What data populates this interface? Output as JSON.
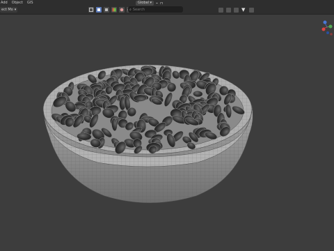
{
  "menu": {
    "items": [
      "Add",
      "Object",
      "GIS"
    ]
  },
  "mode": {
    "label": "Object Mode",
    "short": "ect Mo"
  },
  "header": {
    "pivot_label": "Global",
    "search_placeholder": "Search"
  },
  "icons": [
    "select-box-icon",
    "move-icon",
    "tool-icon",
    "gradient-icon",
    "color-icon",
    "nodes-icon",
    "refresh-icon",
    "filter-icon",
    "view-icon"
  ],
  "colors": {
    "background": "#3d3d3d",
    "header": "#2e2e2e",
    "accent": "#5a79b8",
    "mesh_fill": "#9a9a9a",
    "seed_fill": "#2c2c2c"
  }
}
